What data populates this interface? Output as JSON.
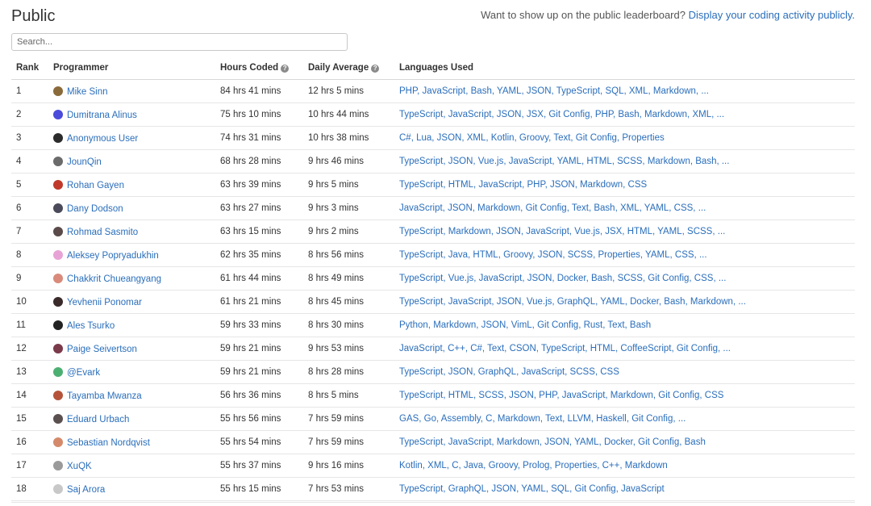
{
  "header": {
    "title": "Public",
    "promo_text": "Want to show up on the public leaderboard? ",
    "promo_link": "Display your coding activity publicly."
  },
  "search": {
    "placeholder": "Search..."
  },
  "columns": {
    "rank": "Rank",
    "programmer": "Programmer",
    "hours": "Hours Coded",
    "daily": "Daily Average",
    "languages": "Languages Used"
  },
  "rows": [
    {
      "rank": "1",
      "name": "Mike Sinn",
      "hours": "84 hrs 41 mins",
      "daily": "12 hrs 5 mins",
      "languages": "PHP, JavaScript, Bash, YAML, JSON, TypeScript, SQL, XML, Markdown, ...",
      "avatar_color": "#8a6a3a"
    },
    {
      "rank": "2",
      "name": "Dumitrana Alinus",
      "hours": "75 hrs 10 mins",
      "daily": "10 hrs 44 mins",
      "languages": "TypeScript, JavaScript, JSON, JSX, Git Config, PHP, Bash, Markdown, XML, ...",
      "avatar_color": "#4a4adb"
    },
    {
      "rank": "3",
      "name": "Anonymous User",
      "hours": "74 hrs 31 mins",
      "daily": "10 hrs 38 mins",
      "languages": "C#, Lua, JSON, XML, Kotlin, Groovy, Text, Git Config, Properties",
      "avatar_color": "#2b2b2b"
    },
    {
      "rank": "4",
      "name": "JounQin",
      "hours": "68 hrs 28 mins",
      "daily": "9 hrs 46 mins",
      "languages": "TypeScript, JSON, Vue.js, JavaScript, YAML, HTML, SCSS, Markdown, Bash, ...",
      "avatar_color": "#6b6b6b"
    },
    {
      "rank": "5",
      "name": "Rohan Gayen",
      "hours": "63 hrs 39 mins",
      "daily": "9 hrs 5 mins",
      "languages": "TypeScript, HTML, JavaScript, PHP, JSON, Markdown, CSS",
      "avatar_color": "#c0392b"
    },
    {
      "rank": "6",
      "name": "Dany Dodson",
      "hours": "63 hrs 27 mins",
      "daily": "9 hrs 3 mins",
      "languages": "JavaScript, JSON, Markdown, Git Config, Text, Bash, XML, YAML, CSS, ...",
      "avatar_color": "#4a4a5a"
    },
    {
      "rank": "7",
      "name": "Rohmad Sasmito",
      "hours": "63 hrs 15 mins",
      "daily": "9 hrs 2 mins",
      "languages": "TypeScript, Markdown, JSON, JavaScript, Vue.js, JSX, HTML, YAML, SCSS, ...",
      "avatar_color": "#5a4a4a"
    },
    {
      "rank": "8",
      "name": "Aleksey Popryadukhin",
      "hours": "62 hrs 35 mins",
      "daily": "8 hrs 56 mins",
      "languages": "TypeScript, Java, HTML, Groovy, JSON, SCSS, Properties, YAML, CSS, ...",
      "avatar_color": "#e7a3d6"
    },
    {
      "rank": "9",
      "name": "Chakkrit Chueangyang",
      "hours": "61 hrs 44 mins",
      "daily": "8 hrs 49 mins",
      "languages": "TypeScript, Vue.js, JavaScript, JSON, Docker, Bash, SCSS, Git Config, CSS, ...",
      "avatar_color": "#d98a7a"
    },
    {
      "rank": "10",
      "name": "Yevhenii Ponomar",
      "hours": "61 hrs 21 mins",
      "daily": "8 hrs 45 mins",
      "languages": "TypeScript, JavaScript, JSON, Vue.js, GraphQL, YAML, Docker, Bash, Markdown, ...",
      "avatar_color": "#3a2a2a"
    },
    {
      "rank": "11",
      "name": "Ales Tsurko",
      "hours": "59 hrs 33 mins",
      "daily": "8 hrs 30 mins",
      "languages": "Python, Markdown, JSON, VimL, Git Config, Rust, Text, Bash",
      "avatar_color": "#222222"
    },
    {
      "rank": "12",
      "name": "Paige Seivertson",
      "hours": "59 hrs 21 mins",
      "daily": "9 hrs 53 mins",
      "languages": "JavaScript, C++, C#, Text, CSON, TypeScript, HTML, CoffeeScript, Git Config, ...",
      "avatar_color": "#7a3a4a"
    },
    {
      "rank": "13",
      "name": "@Evark",
      "hours": "59 hrs 21 mins",
      "daily": "8 hrs 28 mins",
      "languages": "TypeScript, JSON, GraphQL, JavaScript, SCSS, CSS",
      "avatar_color": "#4caf72"
    },
    {
      "rank": "14",
      "name": "Tayamba Mwanza",
      "hours": "56 hrs 36 mins",
      "daily": "8 hrs 5 mins",
      "languages": "TypeScript, HTML, SCSS, JSON, PHP, JavaScript, Markdown, Git Config, CSS",
      "avatar_color": "#b5533a"
    },
    {
      "rank": "15",
      "name": "Eduard Urbach",
      "hours": "55 hrs 56 mins",
      "daily": "7 hrs 59 mins",
      "languages": "GAS, Go, Assembly, C, Markdown, Text, LLVM, Haskell, Git Config, ...",
      "avatar_color": "#5a5050"
    },
    {
      "rank": "16",
      "name": "Sebastian Nordqvist",
      "hours": "55 hrs 54 mins",
      "daily": "7 hrs 59 mins",
      "languages": "TypeScript, JavaScript, Markdown, JSON, YAML, Docker, Git Config, Bash",
      "avatar_color": "#d48a6a"
    },
    {
      "rank": "17",
      "name": "XuQK",
      "hours": "55 hrs 37 mins",
      "daily": "9 hrs 16 mins",
      "languages": "Kotlin, XML, C, Java, Groovy, Prolog, Properties, C++, Markdown",
      "avatar_color": "#9a9a9a"
    },
    {
      "rank": "18",
      "name": "Saj Arora",
      "hours": "55 hrs 15 mins",
      "daily": "7 hrs 53 mins",
      "languages": "TypeScript, GraphQL, JSON, YAML, SQL, Git Config, JavaScript",
      "avatar_color": "#c8c8c8"
    }
  ]
}
